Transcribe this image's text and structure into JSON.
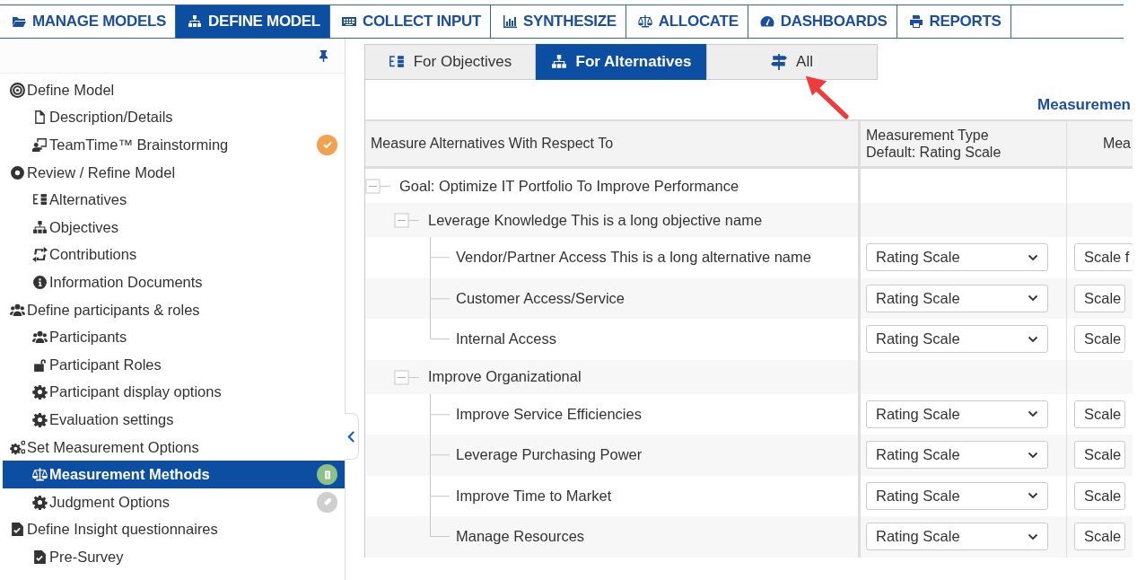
{
  "nav": {
    "tabs": [
      {
        "label": "MANAGE MODELS",
        "selected": false
      },
      {
        "label": "DEFINE MODEL",
        "selected": true
      },
      {
        "label": "COLLECT INPUT",
        "selected": false
      },
      {
        "label": "SYNTHESIZE",
        "selected": false
      },
      {
        "label": "ALLOCATE",
        "selected": false
      },
      {
        "label": "DASHBOARDS",
        "selected": false
      },
      {
        "label": "REPORTS",
        "selected": false
      }
    ]
  },
  "sidebar": {
    "items": [
      {
        "label": "Define Model",
        "selected": false,
        "children": [
          {
            "label": "Description/Details",
            "selected": false
          },
          {
            "label": "TeamTime™ Brainstorming",
            "selected": false,
            "kind": "done"
          }
        ]
      },
      {
        "label": "Review / Refine Model",
        "selected": false,
        "children": [
          {
            "label": "Alternatives",
            "selected": false
          },
          {
            "label": "Objectives",
            "selected": false
          },
          {
            "label": "Contributions",
            "selected": false
          },
          {
            "label": "Information Documents",
            "selected": false
          }
        ]
      },
      {
        "label": "Define participants & roles",
        "selected": false,
        "children": [
          {
            "label": "Participants",
            "selected": false
          },
          {
            "label": "Participant Roles",
            "selected": false
          },
          {
            "label": "Participant display options",
            "selected": false
          },
          {
            "label": "Evaluation settings",
            "selected": false
          }
        ]
      },
      {
        "label": "Set Measurement Options",
        "selected": false,
        "children": [
          {
            "label": "Measurement Methods",
            "selected": true,
            "kind": "current"
          },
          {
            "label": "Judgment Options",
            "selected": false,
            "kind": "inactive"
          }
        ]
      },
      {
        "label": "Define Insight questionnaires",
        "selected": false,
        "children": [
          {
            "label": "Pre-Survey",
            "selected": false
          }
        ]
      }
    ]
  },
  "content": {
    "tabs": [
      {
        "label": "For Objectives",
        "selected": false
      },
      {
        "label": "For Alternatives",
        "selected": true
      },
      {
        "label": "All",
        "selected": false
      }
    ],
    "section_title": "Measuremen",
    "table": {
      "columns": [
        "Measure Alternatives With Respect To",
        "Measurement Type\nDefault: Rating Scale",
        "Mea"
      ],
      "rows": [
        {
          "label": "Goal: Optimize IT Portfolio To Improve Performance",
          "expanded": true,
          "children": [
            {
              "label": "Leverage Knowledge This is a long objective name",
              "expanded": true,
              "children": [
                {
                  "label": "Vendor/Partner Access This is a long alternative name",
                  "measurement_type": "Rating Scale",
                  "column_3": "Scale f"
                },
                {
                  "label": "Customer Access/Service",
                  "measurement_type": "Rating Scale",
                  "column_3": "Scale"
                },
                {
                  "label": "Internal Access",
                  "measurement_type": "Rating Scale",
                  "column_3": "Scale"
                }
              ]
            },
            {
              "label": "Improve Organizational",
              "expanded": true,
              "children": [
                {
                  "label": "Improve Service Efficiencies",
                  "measurement_type": "Rating Scale",
                  "column_3": "Scale"
                },
                {
                  "label": "Leverage Purchasing Power",
                  "measurement_type": "Rating Scale",
                  "column_3": "Scale"
                },
                {
                  "label": "Improve Time to Market",
                  "measurement_type": "Rating Scale",
                  "column_3": "Scale"
                },
                {
                  "label": "Manage Resources",
                  "measurement_type": "Rating Scale",
                  "column_3": "Scale"
                }
              ]
            }
          ]
        }
      ]
    }
  }
}
